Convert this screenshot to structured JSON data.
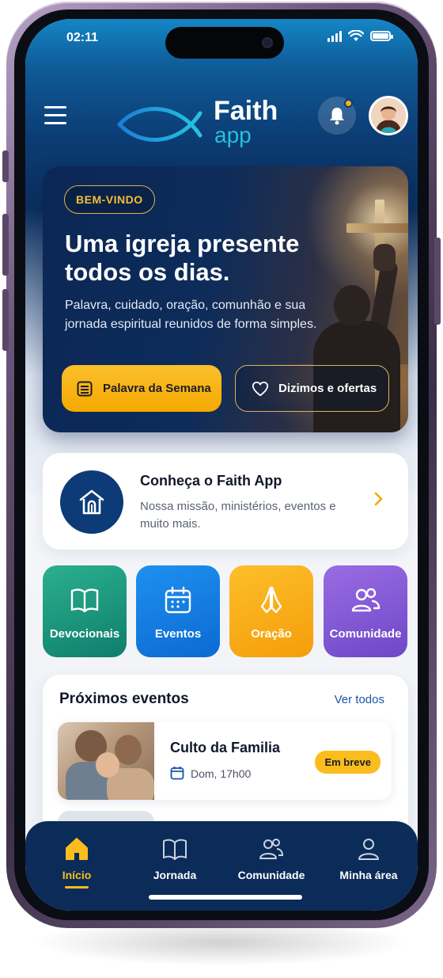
{
  "status_bar": {
    "time": "02:11"
  },
  "app": {
    "logo_word": "Faith",
    "logo_sub": "app"
  },
  "header": {
    "menu_icon": "hamburger-icon",
    "notification_icon": "bell-icon",
    "has_notification": true,
    "avatar": "user-avatar"
  },
  "hero": {
    "badge": "BEM-VINDO",
    "title": "Uma igreja presente todos os dias.",
    "subtitle": "Palavra, cuidado, oração, comunhão e sua jornada espiritual reunidos de forma simples.",
    "primary_button": "Palavra da Semana",
    "secondary_button": "Dizimos e ofertas"
  },
  "about": {
    "title": "Conheça o Faith App",
    "description": "Nossa missão, ministérios, eventos e muito mais."
  },
  "shortcuts": [
    {
      "label": "Devocionais",
      "icon": "book-icon",
      "color": "#1f9b7e"
    },
    {
      "label": "Eventos",
      "icon": "calendar-icon",
      "color": "#1a7fe6"
    },
    {
      "label": "Oração",
      "icon": "praying-hands-icon",
      "color": "#f8ae14"
    },
    {
      "label": "Comunidade",
      "icon": "people-icon",
      "color": "#8159d6"
    }
  ],
  "events": {
    "title": "Próximos eventos",
    "see_all": "Ver todos",
    "items": [
      {
        "name": "Culto da Familia",
        "time": "Dom, 17h00",
        "badge": "Em breve"
      }
    ]
  },
  "tabbar": {
    "items": [
      {
        "label": "Início",
        "icon": "home-icon",
        "active": true
      },
      {
        "label": "Jornada",
        "icon": "book-icon",
        "active": false
      },
      {
        "label": "Comunidade",
        "icon": "people-icon",
        "active": false
      },
      {
        "label": "Minha área",
        "icon": "user-icon",
        "active": false
      }
    ]
  },
  "colors": {
    "accent": "#fbbd1e",
    "navy": "#0b2b58",
    "brand_cyan": "#24c0dc"
  }
}
